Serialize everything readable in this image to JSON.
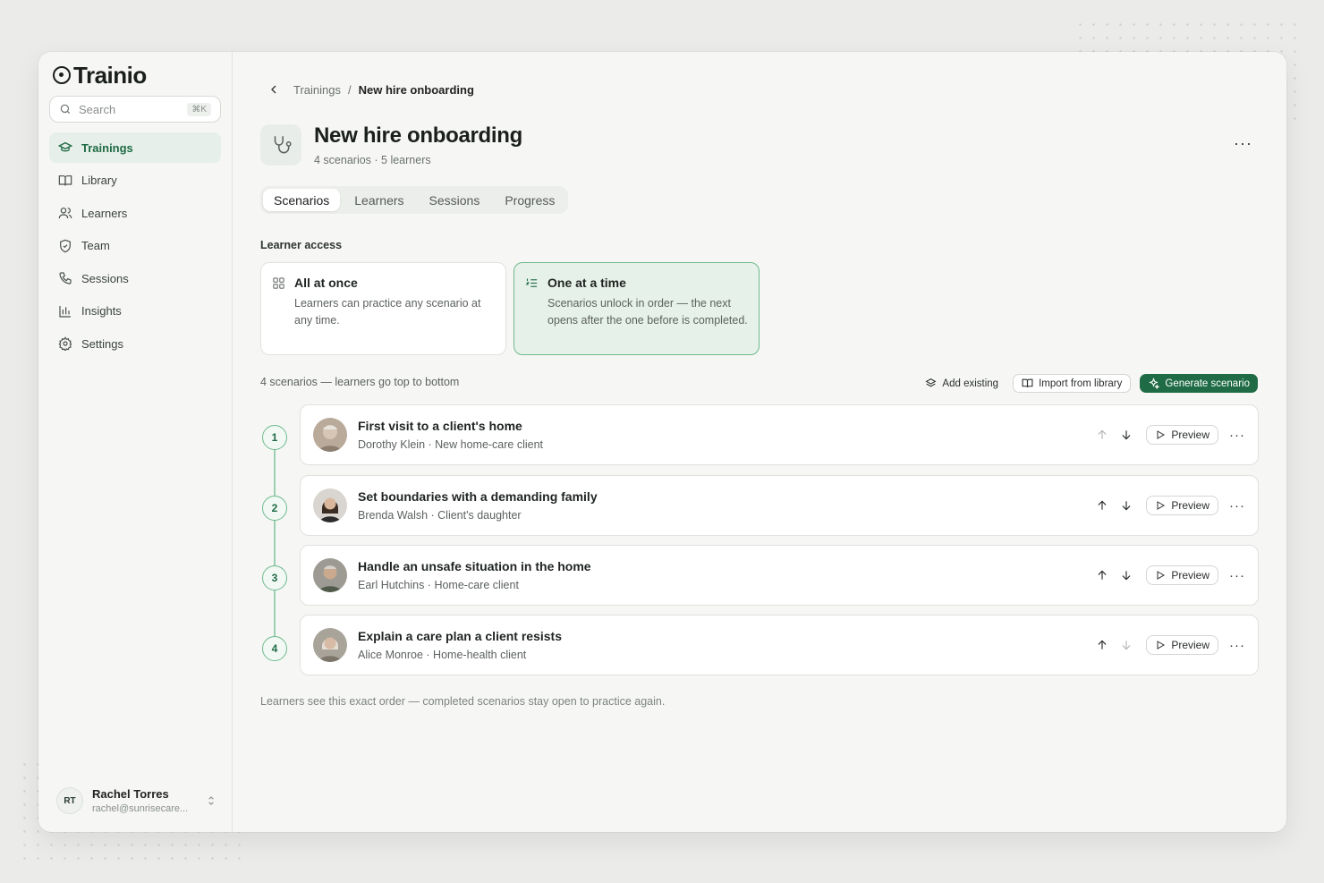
{
  "app": {
    "name": "Trainio"
  },
  "search": {
    "placeholder": "Search",
    "shortcut": "⌘K"
  },
  "sidebar": {
    "items": [
      {
        "label": "Trainings",
        "icon": "graduation-cap-icon",
        "active": true
      },
      {
        "label": "Library",
        "icon": "book-icon"
      },
      {
        "label": "Learners",
        "icon": "users-icon"
      },
      {
        "label": "Team",
        "icon": "shield-icon"
      },
      {
        "label": "Sessions",
        "icon": "phone-icon"
      },
      {
        "label": "Insights",
        "icon": "bar-chart-icon"
      },
      {
        "label": "Settings",
        "icon": "gear-icon"
      }
    ]
  },
  "user": {
    "initials": "RT",
    "name": "Rachel Torres",
    "email": "rachel@sunrisecare..."
  },
  "breadcrumb": {
    "parent": "Trainings",
    "separator": "/",
    "current": "New hire onboarding"
  },
  "header": {
    "title": "New hire onboarding",
    "subtitle": "4 scenarios · 5 learners",
    "more": "···"
  },
  "tabs": [
    {
      "label": "Scenarios",
      "active": true
    },
    {
      "label": "Learners"
    },
    {
      "label": "Sessions"
    },
    {
      "label": "Progress"
    }
  ],
  "access": {
    "label": "Learner access",
    "options": [
      {
        "title": "All at once",
        "desc": "Learners can practice any scenario at any time.",
        "selected": false
      },
      {
        "title": "One at a time",
        "desc": "Scenarios unlock in order — the next opens after the one before is completed.",
        "selected": true
      }
    ]
  },
  "list": {
    "meta": "4 scenarios — learners go top to bottom",
    "actions": {
      "add_existing": "Add existing",
      "import": "Import from library",
      "generate": "Generate scenario"
    },
    "preview_label": "Preview",
    "more": "···",
    "scenarios": [
      {
        "step": "1",
        "title": "First visit to a client's home",
        "persona": "Dorothy Klein · New home-care client"
      },
      {
        "step": "2",
        "title": "Set boundaries with a demanding family",
        "persona": "Brenda Walsh · Client's daughter"
      },
      {
        "step": "3",
        "title": "Handle an unsafe situation in the home",
        "persona": "Earl Hutchins · Home-care client"
      },
      {
        "step": "4",
        "title": "Explain a care plan a client resists",
        "persona": "Alice Monroe · Home-health client"
      }
    ]
  },
  "footnote": "Learners see this exact order — completed scenarios stay open to practice again.",
  "colors": {
    "accent": "#1f6b45",
    "accent_soft": "#e6f1ea",
    "accent_border": "#6fba8d"
  }
}
